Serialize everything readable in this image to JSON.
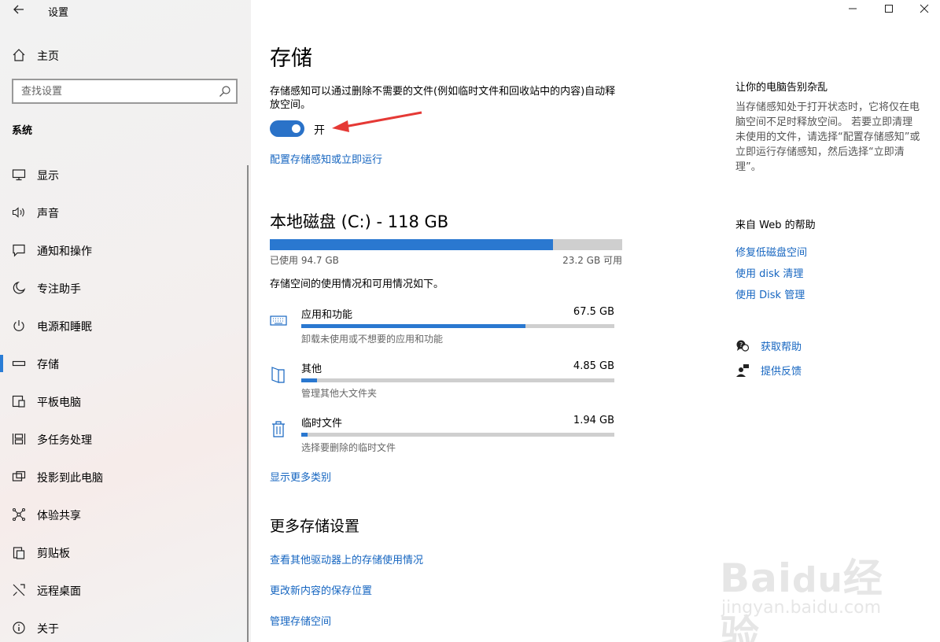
{
  "window": {
    "title": "设置",
    "controls": [
      "minimize",
      "maximize",
      "close"
    ]
  },
  "sidebar": {
    "home_label": "主页",
    "search_placeholder": "查找设置",
    "section_title": "系统",
    "items": [
      {
        "label": "显示",
        "icon": "monitor-icon"
      },
      {
        "label": "声音",
        "icon": "speaker-icon"
      },
      {
        "label": "通知和操作",
        "icon": "notification-icon"
      },
      {
        "label": "专注助手",
        "icon": "moon-icon"
      },
      {
        "label": "电源和睡眠",
        "icon": "power-icon"
      },
      {
        "label": "存储",
        "icon": "storage-icon",
        "active": true
      },
      {
        "label": "平板电脑",
        "icon": "tablet-icon"
      },
      {
        "label": "多任务处理",
        "icon": "multitask-icon"
      },
      {
        "label": "投影到此电脑",
        "icon": "project-icon"
      },
      {
        "label": "体验共享",
        "icon": "share-icon"
      },
      {
        "label": "剪贴板",
        "icon": "clipboard-icon"
      },
      {
        "label": "远程桌面",
        "icon": "remote-desktop-icon"
      },
      {
        "label": "关于",
        "icon": "info-icon"
      }
    ]
  },
  "main": {
    "title": "存储",
    "description": "存储感知可以通过删除不需要的文件(例如临时文件和回收站中的内容)自动释放空间。",
    "toggle": {
      "state_label": "开",
      "on": true
    },
    "configure_link": "配置存储感知或立即运行",
    "disk": {
      "title": "本地磁盘 (C:) - 118 GB",
      "used_label": "已使用 94.7 GB",
      "free_label": "23.2 GB 可用",
      "used_fraction": 0.8025
    },
    "usage_description": "存储空间的使用情况和可用情况如下。",
    "categories": [
      {
        "name": "应用和功能",
        "size": "67.5 GB",
        "sub": "卸载未使用或不想要的应用和功能",
        "fraction": 0.715,
        "icon": "keyboard-icon"
      },
      {
        "name": "其他",
        "size": "4.85 GB",
        "sub": "管理其他大文件夹",
        "fraction": 0.05,
        "icon": "document-icon"
      },
      {
        "name": "临时文件",
        "size": "1.94 GB",
        "sub": "选择要删除的临时文件",
        "fraction": 0.02,
        "icon": "trash-icon"
      }
    ],
    "show_more_link": "显示更多类别",
    "more_settings_title": "更多存储设置",
    "more_links": [
      "查看其他驱动器上的存储使用情况",
      "更改新内容的保存位置",
      "管理存储空间"
    ]
  },
  "right": {
    "heading1": "让你的电脑告别杂乱",
    "paragraph": "当存储感知处于打开状态时，它将仅在电脑空间不足时释放空间。 若要立即清理未使用的文件，请选择“配置存储感知”或立即运行存储感知，然后选择“立即清理”。",
    "heading2": "来自 Web 的帮助",
    "web_links": [
      "修复低磁盘空间",
      "使用 disk 清理",
      "使用 Disk 管理"
    ],
    "help_label": "获取帮助",
    "feedback_label": "提供反馈"
  },
  "watermark": {
    "logo": "Baidu经验",
    "url": "jingyan.baidu.com"
  },
  "colors": {
    "accent": "#2a78d0",
    "link": "#1565c0",
    "arrow": "#e53935"
  }
}
